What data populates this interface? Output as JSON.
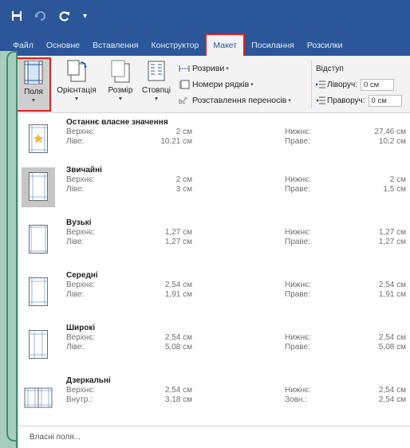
{
  "quick_access": {
    "save_icon": "save-icon",
    "undo_icon": "undo-icon",
    "redo_icon": "redo-icon",
    "customize_icon": "customize-icon"
  },
  "tabs": [
    {
      "label": "Файл",
      "active": false
    },
    {
      "label": "Основне",
      "active": false
    },
    {
      "label": "Вставлення",
      "active": false
    },
    {
      "label": "Конструктор",
      "active": false
    },
    {
      "label": "Макет",
      "active": true
    },
    {
      "label": "Посилання",
      "active": false
    },
    {
      "label": "Розсилки",
      "active": false
    }
  ],
  "ribbon": {
    "buttons": [
      {
        "label": "Поля",
        "icon": "margins-icon"
      },
      {
        "label": "Орієнтація",
        "icon": "orientation-icon"
      },
      {
        "label": "Розмір",
        "icon": "size-icon"
      },
      {
        "label": "Стовпці",
        "icon": "columns-icon"
      }
    ],
    "breaks": "Розриви",
    "line_numbers": "Номери рядків",
    "hyphenation": "Розставлення переносів",
    "indent": {
      "title": "Відступ",
      "left_label": "Ліворуч:",
      "left_value": "0 см",
      "right_label": "Праворуч:",
      "right_value": "0 см"
    }
  },
  "margins_menu": {
    "items": [
      {
        "name": "Останнє власне значення",
        "k1": "Верхнє:",
        "v1": "2 см",
        "k2": "Нижнє:",
        "v2": "27,46 см",
        "k3": "Ліве:",
        "v3": "10,21 см",
        "k4": "Праве:",
        "v4": "10,2 см",
        "selected": false
      },
      {
        "name": "Звичайні",
        "k1": "Верхнє:",
        "v1": "2 см",
        "k2": "Нижнє:",
        "v2": "2 см",
        "k3": "Ліве:",
        "v3": "3 см",
        "k4": "Праве:",
        "v4": "1,5 см",
        "selected": true
      },
      {
        "name": "Вузькі",
        "k1": "Верхнє:",
        "v1": "1,27 см",
        "k2": "Нижнє:",
        "v2": "1,27 см",
        "k3": "Ліве:",
        "v3": "1,27 см",
        "k4": "Праве:",
        "v4": "1,27 см",
        "selected": false
      },
      {
        "name": "Середні",
        "k1": "Верхнє:",
        "v1": "2,54 см",
        "k2": "Нижнє:",
        "v2": "2,54 см",
        "k3": "Ліве:",
        "v3": "1,91 см",
        "k4": "Праве:",
        "v4": "1,91 см",
        "selected": false
      },
      {
        "name": "Широкі",
        "k1": "Верхнє:",
        "v1": "2,54 см",
        "k2": "Нижнє:",
        "v2": "2,54 см",
        "k3": "Ліве:",
        "v3": "5,08 см",
        "k4": "Праве:",
        "v4": "5,08 см",
        "selected": false
      },
      {
        "name": "Дзеркальні",
        "k1": "Верхнє:",
        "v1": "2,54 см",
        "k2": "Нижнє:",
        "v2": "2,54 см",
        "k3": "Внутр.:",
        "v3": "3,18 см",
        "k4": "Зовн.:",
        "v4": "2,54 см",
        "selected": false
      }
    ],
    "custom_label": "Власні поля..."
  },
  "colors": {
    "title_bar": "#2b579a",
    "highlight_border": "#e02020",
    "frame_green": "#3e8f73"
  }
}
